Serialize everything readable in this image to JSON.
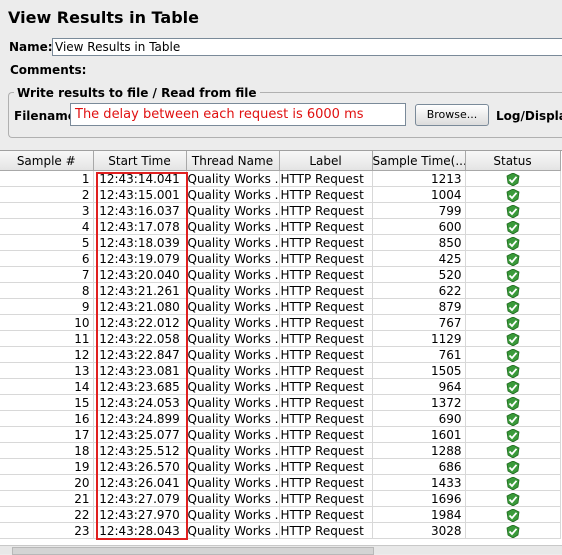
{
  "title": "View Results in Table",
  "name_label": "Name:",
  "name_value": "View Results in Table",
  "comments_label": "Comments:",
  "file_section": {
    "legend": "Write results to file / Read from file",
    "filename_label": "Filename",
    "filename_value": "The delay between each request is 6000 ms",
    "browse_label": "Browse...",
    "log_display_label": "Log/Display"
  },
  "table": {
    "columns": [
      "Sample #",
      "Start Time",
      "Thread Name",
      "Label",
      "Sample Time(...",
      "Status"
    ],
    "rows": [
      [
        "1",
        "12:43:14.041",
        "Quality Works ...",
        "HTTP Request",
        "1213"
      ],
      [
        "2",
        "12:43:15.001",
        "Quality Works ...",
        "HTTP Request",
        "1004"
      ],
      [
        "3",
        "12:43:16.037",
        "Quality Works ...",
        "HTTP Request",
        "799"
      ],
      [
        "4",
        "12:43:17.078",
        "Quality Works ...",
        "HTTP Request",
        "600"
      ],
      [
        "5",
        "12:43:18.039",
        "Quality Works ...",
        "HTTP Request",
        "850"
      ],
      [
        "6",
        "12:43:19.079",
        "Quality Works ...",
        "HTTP Request",
        "425"
      ],
      [
        "7",
        "12:43:20.040",
        "Quality Works ...",
        "HTTP Request",
        "520"
      ],
      [
        "8",
        "12:43:21.261",
        "Quality Works ...",
        "HTTP Request",
        "622"
      ],
      [
        "9",
        "12:43:21.080",
        "Quality Works ...",
        "HTTP Request",
        "879"
      ],
      [
        "10",
        "12:43:22.012",
        "Quality Works ...",
        "HTTP Request",
        "767"
      ],
      [
        "11",
        "12:43:22.058",
        "Quality Works ...",
        "HTTP Request",
        "1129"
      ],
      [
        "12",
        "12:43:22.847",
        "Quality Works ...",
        "HTTP Request",
        "761"
      ],
      [
        "13",
        "12:43:23.081",
        "Quality Works ...",
        "HTTP Request",
        "1505"
      ],
      [
        "14",
        "12:43:23.685",
        "Quality Works ...",
        "HTTP Request",
        "964"
      ],
      [
        "15",
        "12:43:24.053",
        "Quality Works ...",
        "HTTP Request",
        "1372"
      ],
      [
        "16",
        "12:43:24.899",
        "Quality Works ...",
        "HTTP Request",
        "690"
      ],
      [
        "17",
        "12:43:25.077",
        "Quality Works ...",
        "HTTP Request",
        "1601"
      ],
      [
        "18",
        "12:43:25.512",
        "Quality Works ...",
        "HTTP Request",
        "1288"
      ],
      [
        "19",
        "12:43:26.570",
        "Quality Works ...",
        "HTTP Request",
        "686"
      ],
      [
        "20",
        "12:43:26.041",
        "Quality Works ...",
        "HTTP Request",
        "1433"
      ],
      [
        "21",
        "12:43:27.079",
        "Quality Works ...",
        "HTTP Request",
        "1696"
      ],
      [
        "22",
        "12:43:27.970",
        "Quality Works ...",
        "HTTP Request",
        "1984"
      ],
      [
        "23",
        "12:43:28.043",
        "Quality Works ...",
        "HTTP Request",
        "3028"
      ]
    ],
    "status_icon": "success-shield-check-icon"
  },
  "colors": {
    "highlight": "#e02020",
    "filename_text": "#e01010",
    "status_green": "#3a9a3a"
  }
}
